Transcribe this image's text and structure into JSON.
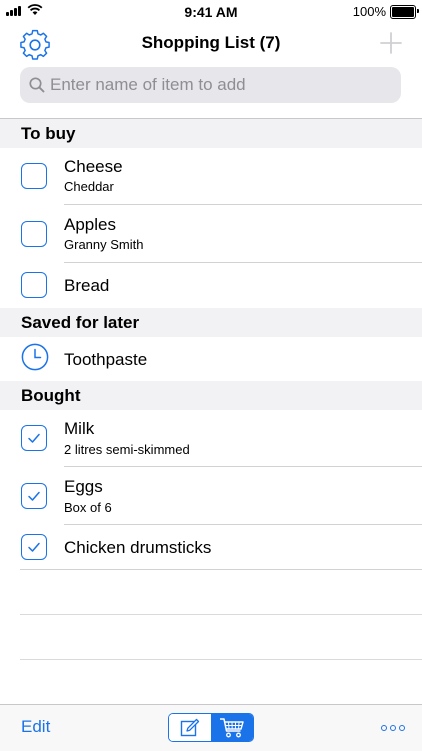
{
  "status_bar": {
    "time": "9:41 AM",
    "battery": "100%"
  },
  "nav": {
    "title": "Shopping List (7)"
  },
  "search": {
    "placeholder": "Enter name of item to add"
  },
  "sections": {
    "to_buy": "To buy",
    "saved_for_later": "Saved for later",
    "bought": "Bought"
  },
  "items": {
    "cheese": {
      "title": "Cheese",
      "subtitle": "Cheddar",
      "checked": false
    },
    "apples": {
      "title": "Apples",
      "subtitle": "Granny Smith",
      "checked": false
    },
    "bread": {
      "title": "Bread",
      "checked": false
    },
    "toothpaste": {
      "title": "Toothpaste"
    },
    "milk": {
      "title": "Milk",
      "subtitle": "2 litres semi-skimmed",
      "checked": true
    },
    "eggs": {
      "title": "Eggs",
      "subtitle": "Box of 6",
      "checked": true
    },
    "chicken": {
      "title": "Chicken drumsticks",
      "checked": true
    }
  },
  "toolbar": {
    "edit_label": "Edit"
  },
  "colors": {
    "accent": "#1a73e8",
    "section_bg": "#f2f2f4",
    "search_bg": "#e6e6eb"
  }
}
